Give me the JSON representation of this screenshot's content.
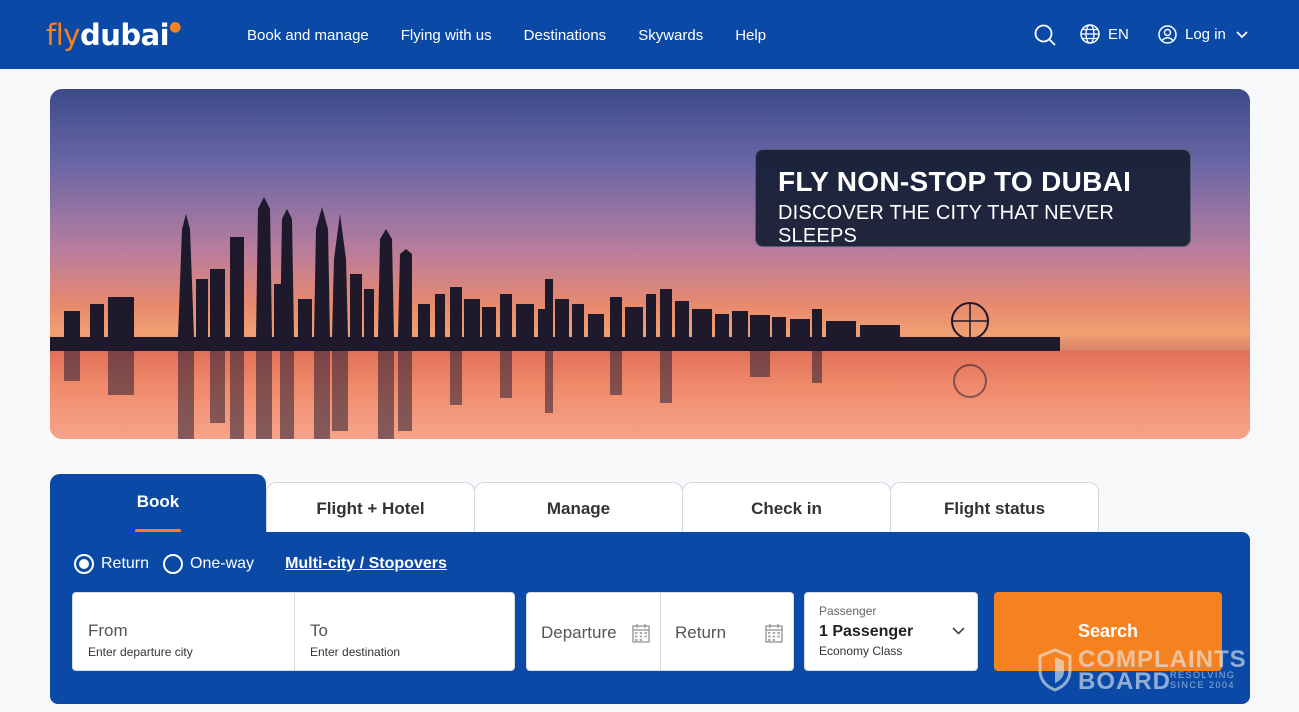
{
  "brand": {
    "logo_fly": "fly",
    "logo_dubai": "dubai",
    "accent": "#f5821f",
    "primary": "#0a4aa6"
  },
  "nav": {
    "items": [
      "Book and manage",
      "Flying with us",
      "Destinations",
      "Skywards",
      "Help"
    ]
  },
  "header": {
    "language": "EN",
    "login_label": "Log in"
  },
  "hero": {
    "headline": "FLY NON-STOP TO DUBAI",
    "subline": "DISCOVER THE CITY THAT NEVER SLEEPS"
  },
  "tabs": [
    "Book",
    "Flight + Hotel",
    "Manage",
    "Check in",
    "Flight status"
  ],
  "booking": {
    "trip_types": [
      "Return",
      "One-way"
    ],
    "selected_trip": "Return",
    "multi_city": "Multi-city / Stopovers",
    "from_label": "From",
    "from_hint": "Enter departure city",
    "to_label": "To",
    "to_hint": "Enter destination",
    "departure_label": "Departure",
    "return_label": "Return",
    "passenger_label": "Passenger",
    "passenger_value": "1 Passenger",
    "cabin_class": "Economy Class",
    "search_label": "Search"
  },
  "watermark": {
    "line1": "COMPLAINTS",
    "line2": "BOARD",
    "tag1": "RESOLVING",
    "tag2": "SINCE 2004"
  }
}
